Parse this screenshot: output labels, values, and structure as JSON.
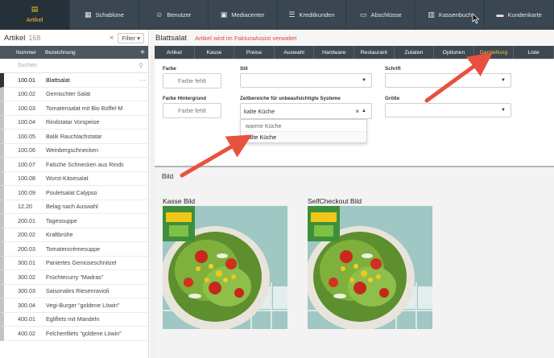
{
  "topnav": [
    {
      "label": "Artikel",
      "icon": "barcode-icon",
      "glyph": "▤",
      "active": true
    },
    {
      "label": "Schablone",
      "icon": "template-icon",
      "glyph": "▦"
    },
    {
      "label": "Benutzer",
      "icon": "users-icon",
      "glyph": "☺"
    },
    {
      "label": "Mediacenter",
      "icon": "media-icon",
      "glyph": "▣"
    },
    {
      "label": "Kreditkunden",
      "icon": "credit-customers-icon",
      "glyph": "☰"
    },
    {
      "label": "Abschlüsse",
      "icon": "closings-icon",
      "glyph": "▭"
    },
    {
      "label": "Kassenbuch",
      "icon": "cashbook-icon",
      "glyph": "▥"
    },
    {
      "label": "Kundenkarte",
      "icon": "customer-card-icon",
      "glyph": "▬"
    }
  ],
  "left": {
    "title": "Artikel",
    "count": "168",
    "clear": "×",
    "filter_label": "Filter ▾",
    "col_number": "Nummer",
    "col_name": "Bezeichnung",
    "add": "+",
    "search_placeholder": "Suchen",
    "rows": [
      {
        "num": "100.01",
        "name": "Blattsalat",
        "active": true
      },
      {
        "num": "100.02",
        "name": "Gemischter Salat"
      },
      {
        "num": "100.03",
        "name": "Tomatensalat mit Bio Büffel-M"
      },
      {
        "num": "100.04",
        "name": "Rindstatar Vorspeise"
      },
      {
        "num": "100.05",
        "name": "Balik Rauchlachstatar"
      },
      {
        "num": "100.06",
        "name": "Weinbergschnecken"
      },
      {
        "num": "100.07",
        "name": "Falsche Schnecken aus Rinds"
      },
      {
        "num": "100.08",
        "name": "Wurst-Käsesalat"
      },
      {
        "num": "100.09",
        "name": "Pouletsalat Calypso"
      },
      {
        "num": "12.20",
        "name": "Belag nach Auswahl"
      },
      {
        "num": "200.01",
        "name": "Tagessuppe"
      },
      {
        "num": "200.02",
        "name": "Kraftbrühe"
      },
      {
        "num": "200.03",
        "name": "Tomatencrèmesuppe"
      },
      {
        "num": "300.01",
        "name": "Paniertes Gemüseschnitzel"
      },
      {
        "num": "300.02",
        "name": "Früchtecurry \"Madras\""
      },
      {
        "num": "300.03",
        "name": "Saisonales Riesenravioli"
      },
      {
        "num": "300.04",
        "name": "Vegi-Burger \"goldene Löwin\""
      },
      {
        "num": "400.01",
        "name": "Egliflets mit Mandeln"
      },
      {
        "num": "400.02",
        "name": "Felchenfilets \"goldene Löwin\""
      }
    ]
  },
  "right": {
    "title": "Blattsalat",
    "note": "Artikel wird im FakturaAssist verwaltet",
    "tabs": [
      "Artikel",
      "Kasse",
      "Preise",
      "Auswahl",
      "Hardware",
      "Restaurant",
      "Zutaten",
      "Optionen",
      "Darstellung",
      "Liste"
    ],
    "active_tab": "Darstellung",
    "form": {
      "farbe_label": "Farbe",
      "farbe_value": "Farbe fehlt",
      "stil_label": "Stil",
      "schrift_label": "Schrift",
      "farbe_hg_label": "Farbe Hintergrund",
      "farbe_hg_value": "Farbe fehlt",
      "zeit_label": "Zeitbereiche für unbeaufsichtigte Systeme",
      "zeit_value": "kalte Küche",
      "groesse_label": "Größe",
      "dropdown_options": [
        "warme Küche",
        "kalte Küche"
      ]
    },
    "bild_title": "Bild",
    "kasse_bild_label": "Kasse Bild",
    "selfcheckout_label": "SelfCheckout Bild"
  },
  "colors": {
    "nav_bg": "#3a4651",
    "accent_yellow": "#f1c232",
    "arrow_red": "#e8513f",
    "note_red": "#e0463c"
  }
}
